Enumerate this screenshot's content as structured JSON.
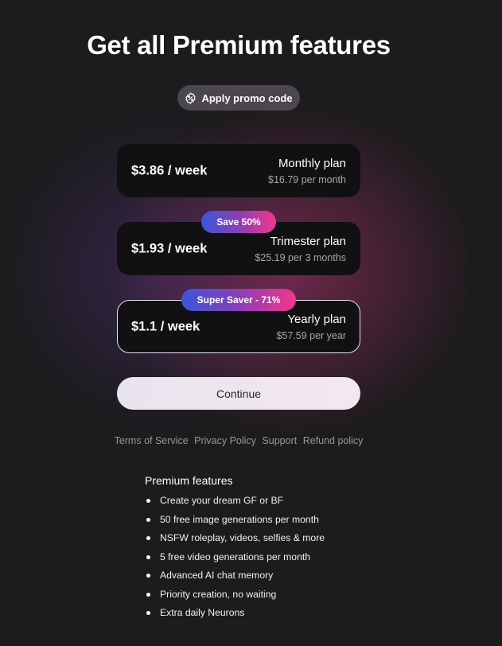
{
  "title": "Get all Premium features",
  "promo": {
    "label": "Apply promo code",
    "icon": "discount-badge-icon"
  },
  "plans": [
    {
      "price": "$3.86 / week",
      "name": "Monthly plan",
      "sub": "$16.79 per month",
      "badge": "",
      "selected": false
    },
    {
      "price": "$1.93 / week",
      "name": "Trimester plan",
      "sub": "$25.19 per 3 months",
      "badge": "Save 50%",
      "selected": false
    },
    {
      "price": "$1.1 / week",
      "name": "Yearly plan",
      "sub": "$57.59 per year",
      "badge": "Super Saver - 71%",
      "selected": true
    }
  ],
  "continue_label": "Continue",
  "links": [
    "Terms of Service",
    "Privacy Policy",
    "Support",
    "Refund policy"
  ],
  "features": {
    "heading": "Premium features",
    "items": [
      "Create your dream GF or BF",
      "50 free image generations per month",
      "NSFW roleplay, videos, selfies & more",
      "5 free video generations per month",
      "Advanced AI chat memory",
      "Priority creation, no waiting",
      "Extra daily Neurons"
    ]
  },
  "colors": {
    "background": "#1c1b1d",
    "card": "#111012",
    "badge_start": "#3a57d6",
    "badge_end": "#f2368c"
  }
}
